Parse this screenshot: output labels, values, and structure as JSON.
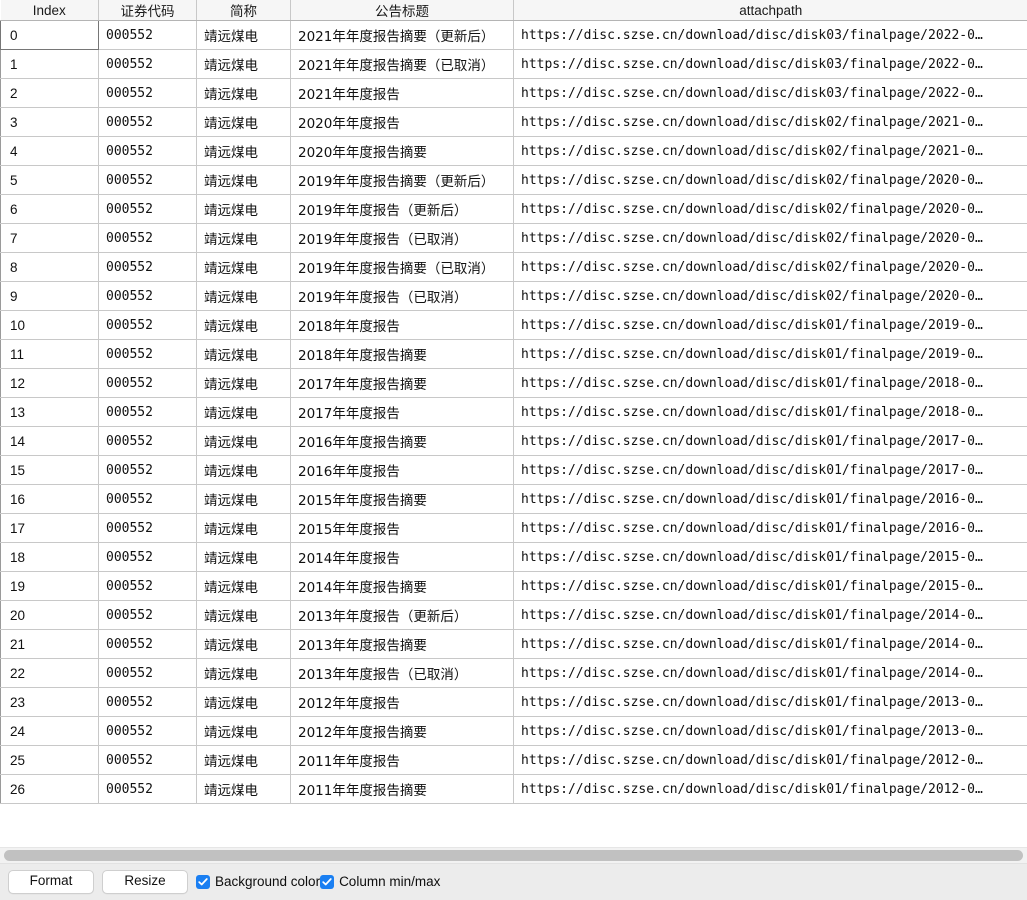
{
  "table": {
    "columns": [
      {
        "key": "index",
        "label": "Index"
      },
      {
        "key": "code",
        "label": "证券代码"
      },
      {
        "key": "short_name",
        "label": "简称"
      },
      {
        "key": "title",
        "label": "公告标题"
      },
      {
        "key": "attachpath",
        "label": "attachpath"
      }
    ],
    "rows": [
      {
        "index": "0",
        "code": "000552",
        "short_name": "靖远煤电",
        "title": "2021年年度报告摘要（更新后）",
        "attachpath": "https://disc.szse.cn/download/disc/disk03/finalpage/2022-0…"
      },
      {
        "index": "1",
        "code": "000552",
        "short_name": "靖远煤电",
        "title": "2021年年度报告摘要（已取消）",
        "attachpath": "https://disc.szse.cn/download/disc/disk03/finalpage/2022-0…"
      },
      {
        "index": "2",
        "code": "000552",
        "short_name": "靖远煤电",
        "title": "2021年年度报告",
        "attachpath": "https://disc.szse.cn/download/disc/disk03/finalpage/2022-0…"
      },
      {
        "index": "3",
        "code": "000552",
        "short_name": "靖远煤电",
        "title": "2020年年度报告",
        "attachpath": "https://disc.szse.cn/download/disc/disk02/finalpage/2021-0…"
      },
      {
        "index": "4",
        "code": "000552",
        "short_name": "靖远煤电",
        "title": "2020年年度报告摘要",
        "attachpath": "https://disc.szse.cn/download/disc/disk02/finalpage/2021-0…"
      },
      {
        "index": "5",
        "code": "000552",
        "short_name": "靖远煤电",
        "title": "2019年年度报告摘要（更新后）",
        "attachpath": "https://disc.szse.cn/download/disc/disk02/finalpage/2020-0…"
      },
      {
        "index": "6",
        "code": "000552",
        "short_name": "靖远煤电",
        "title": "2019年年度报告（更新后）",
        "attachpath": "https://disc.szse.cn/download/disc/disk02/finalpage/2020-0…"
      },
      {
        "index": "7",
        "code": "000552",
        "short_name": "靖远煤电",
        "title": "2019年年度报告（已取消）",
        "attachpath": "https://disc.szse.cn/download/disc/disk02/finalpage/2020-0…"
      },
      {
        "index": "8",
        "code": "000552",
        "short_name": "靖远煤电",
        "title": "2019年年度报告摘要（已取消）",
        "attachpath": "https://disc.szse.cn/download/disc/disk02/finalpage/2020-0…"
      },
      {
        "index": "9",
        "code": "000552",
        "short_name": "靖远煤电",
        "title": "2019年年度报告（已取消）",
        "attachpath": "https://disc.szse.cn/download/disc/disk02/finalpage/2020-0…"
      },
      {
        "index": "10",
        "code": "000552",
        "short_name": "靖远煤电",
        "title": "2018年年度报告",
        "attachpath": "https://disc.szse.cn/download/disc/disk01/finalpage/2019-0…"
      },
      {
        "index": "11",
        "code": "000552",
        "short_name": "靖远煤电",
        "title": "2018年年度报告摘要",
        "attachpath": "https://disc.szse.cn/download/disc/disk01/finalpage/2019-0…"
      },
      {
        "index": "12",
        "code": "000552",
        "short_name": "靖远煤电",
        "title": "2017年年度报告摘要",
        "attachpath": "https://disc.szse.cn/download/disc/disk01/finalpage/2018-0…"
      },
      {
        "index": "13",
        "code": "000552",
        "short_name": "靖远煤电",
        "title": "2017年年度报告",
        "attachpath": "https://disc.szse.cn/download/disc/disk01/finalpage/2018-0…"
      },
      {
        "index": "14",
        "code": "000552",
        "short_name": "靖远煤电",
        "title": "2016年年度报告摘要",
        "attachpath": "https://disc.szse.cn/download/disc/disk01/finalpage/2017-0…"
      },
      {
        "index": "15",
        "code": "000552",
        "short_name": "靖远煤电",
        "title": "2016年年度报告",
        "attachpath": "https://disc.szse.cn/download/disc/disk01/finalpage/2017-0…"
      },
      {
        "index": "16",
        "code": "000552",
        "short_name": "靖远煤电",
        "title": "2015年年度报告摘要",
        "attachpath": "https://disc.szse.cn/download/disc/disk01/finalpage/2016-0…"
      },
      {
        "index": "17",
        "code": "000552",
        "short_name": "靖远煤电",
        "title": "2015年年度报告",
        "attachpath": "https://disc.szse.cn/download/disc/disk01/finalpage/2016-0…"
      },
      {
        "index": "18",
        "code": "000552",
        "short_name": "靖远煤电",
        "title": "2014年年度报告",
        "attachpath": "https://disc.szse.cn/download/disc/disk01/finalpage/2015-0…"
      },
      {
        "index": "19",
        "code": "000552",
        "short_name": "靖远煤电",
        "title": "2014年年度报告摘要",
        "attachpath": "https://disc.szse.cn/download/disc/disk01/finalpage/2015-0…"
      },
      {
        "index": "20",
        "code": "000552",
        "short_name": "靖远煤电",
        "title": "2013年年度报告（更新后）",
        "attachpath": "https://disc.szse.cn/download/disc/disk01/finalpage/2014-0…"
      },
      {
        "index": "21",
        "code": "000552",
        "short_name": "靖远煤电",
        "title": "2013年年度报告摘要",
        "attachpath": "https://disc.szse.cn/download/disc/disk01/finalpage/2014-0…"
      },
      {
        "index": "22",
        "code": "000552",
        "short_name": "靖远煤电",
        "title": "2013年年度报告（已取消）",
        "attachpath": "https://disc.szse.cn/download/disc/disk01/finalpage/2014-0…"
      },
      {
        "index": "23",
        "code": "000552",
        "short_name": "靖远煤电",
        "title": "2012年年度报告",
        "attachpath": "https://disc.szse.cn/download/disc/disk01/finalpage/2013-0…"
      },
      {
        "index": "24",
        "code": "000552",
        "short_name": "靖远煤电",
        "title": "2012年年度报告摘要",
        "attachpath": "https://disc.szse.cn/download/disc/disk01/finalpage/2013-0…"
      },
      {
        "index": "25",
        "code": "000552",
        "short_name": "靖远煤电",
        "title": "2011年年度报告",
        "attachpath": "https://disc.szse.cn/download/disc/disk01/finalpage/2012-0…"
      },
      {
        "index": "26",
        "code": "000552",
        "short_name": "靖远煤电",
        "title": "2011年年度报告摘要",
        "attachpath": "https://disc.szse.cn/download/disc/disk01/finalpage/2012-0…"
      }
    ],
    "focused_row": 0
  },
  "toolbar": {
    "format_label": "Format",
    "resize_label": "Resize",
    "background_color_label": "Background color",
    "background_color_checked": true,
    "column_minmax_label": "Column min/max",
    "column_minmax_checked": true
  },
  "colors": {
    "header_bg": "#f6f6f6",
    "grid_line": "#c8c8c8",
    "checkbox_accent": "#1a7ff2",
    "toolbar_bg": "#ececec",
    "scrollbar_thumb": "#c1c1c1"
  }
}
